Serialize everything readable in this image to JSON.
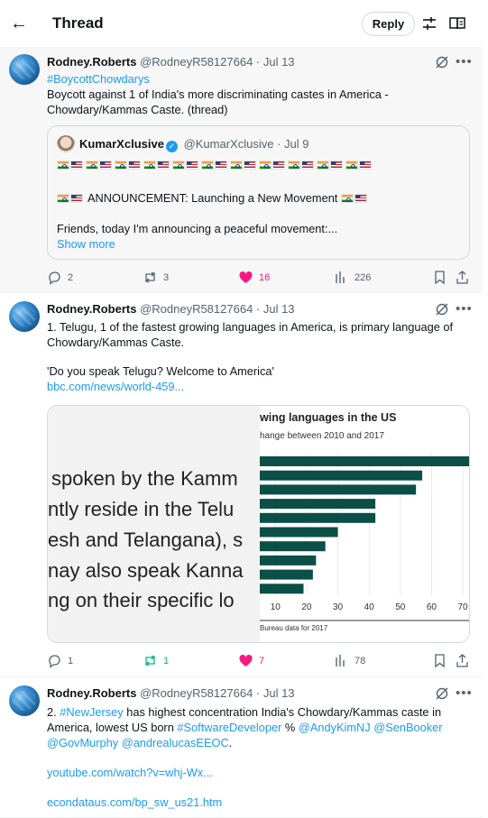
{
  "header": {
    "title": "Thread",
    "reply_label": "Reply"
  },
  "tweets": [
    {
      "name": "Rodney.Roberts",
      "handle": "@RodneyR58127664 · Jul 13",
      "hashtag": "#BoycottChowdarys",
      "text": "Boycott against 1 of India's more discriminating castes in America - Chowdary/Kammas Caste. (thread)",
      "quote": {
        "name": "KumarXclusive",
        "handle": "@KumarXclusive · Jul 9",
        "announcement": "ANNOUNCEMENT: Launching a New Movement",
        "friends": "Friends, today I'm announcing a peaceful movement:...",
        "show_more": "Show more"
      },
      "replies": "2",
      "reposts": "3",
      "likes": "16",
      "views": "226",
      "like_color": "#f91880",
      "repost_color": "#536471"
    },
    {
      "name": "Rodney.Roberts",
      "handle": "@RodneyR58127664 · Jul 13",
      "text_line1": "1. Telugu, 1 of the fastest growing languages in America, is primary language of",
      "text_line2": "Chowdary/Kammas Caste.",
      "quote_text": "'Do you speak Telugu? Welcome to America'",
      "link": "bbc.com/news/world-459...",
      "media": {
        "lines": [
          "spoken by the Kamm",
          "ntly reside in the Telu",
          "esh and Telangana), s",
          "nay also speak Kanna",
          "ng on their specific lo"
        ]
      },
      "replies": "1",
      "reposts": "1",
      "likes": "7",
      "views": "78",
      "like_color": "#f91880",
      "repost_color": "#00ba7c"
    },
    {
      "name": "Rodney.Roberts",
      "handle": "@RodneyR58127664 · Jul 13",
      "prefix": "2. ",
      "hashtag1": "#NewJersey",
      "text_a": " has highest concentration India's Chowdary/Kammas caste in",
      "text_b": "America, lowest US born ",
      "hashtag2": "#SoftwareDeveloper",
      "text_c": " % ",
      "mention1": "@AndyKimNJ",
      "mention2": "@SenBooker",
      "mention3": "@GovMurphy",
      "mention4": "@andrealucasEEOC",
      "period": ".",
      "link1": "youtube.com/watch?v=whj-Wx...",
      "link2": "econdataus.com/bp_sw_us21.htm"
    }
  ],
  "chart_data": {
    "type": "bar",
    "title": "wing languages in the US",
    "subtitle": "hange between 2010 and 2017",
    "source": "Bureau data for 2017",
    "categories": [
      "",
      "",
      "",
      "",
      "",
      "",
      "",
      "",
      "",
      ""
    ],
    "values": [
      86,
      57,
      55,
      42,
      42,
      30,
      26,
      23,
      22,
      19
    ],
    "xlim": [
      5,
      72
    ],
    "xticks": [
      "10",
      "20",
      "30",
      "40",
      "50",
      "60",
      "70"
    ],
    "bar_color": "#0b4f46"
  }
}
